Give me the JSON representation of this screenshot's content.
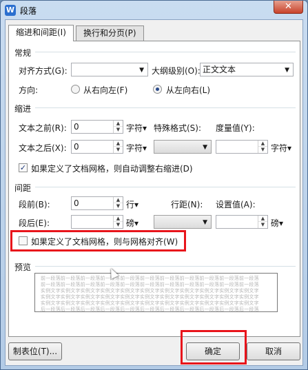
{
  "window": {
    "title": "段落",
    "close": "✕"
  },
  "tabs": [
    {
      "label": "缩进和间距(I)"
    },
    {
      "label": "换行和分页(P)"
    }
  ],
  "general": {
    "section": "常规",
    "align_label": "对齐方式(G):",
    "align_value": "",
    "outline_label": "大纲级别(O):",
    "outline_value": "正文文本",
    "direction_label": "方向:",
    "rtl_label": "从右向左(F)",
    "ltr_label": "从左向右(L)"
  },
  "indent": {
    "section": "缩进",
    "before_label": "文本之前(R):",
    "before_value": "0",
    "before_unit": "字符▾",
    "after_label": "文本之后(X):",
    "after_value": "0",
    "after_unit": "字符▾",
    "special_label": "特殊格式(S):",
    "special_value": "",
    "measure_label": "度量值(Y):",
    "measure_value": "",
    "measure_unit": "字符▾",
    "auto_adjust_label": "如果定义了文档网格，则自动调整右缩进(D)"
  },
  "spacing": {
    "section": "间距",
    "before_label": "段前(B):",
    "before_value": "0",
    "before_unit": "行▾",
    "after_label": "段后(E):",
    "after_value": "",
    "after_unit": "磅▾",
    "line_label": "行距(N):",
    "line_value": "",
    "set_label": "设置值(A):",
    "set_value": "",
    "set_unit": "磅▾",
    "grid_label": "如果定义了文档网格，则与网格对齐(W)"
  },
  "preview": {
    "section": "预览",
    "lines": [
      "前一段落前一段落前一段落前一段落前一段落前一段落前一段落前一段落前一段落前一段落前一段落",
      "前一段落前一段落前一段落前一段落前一段落前一段落前一段落前一段落前一段落前一段落前一段落",
      "实例文字实例文字实例文字实例文字实例文字实例文字实例文字实例文字实例文字实例文字实例文字",
      "实例文字实例文字实例文字实例文字实例文字实例文字实例文字实例文字实例文字实例文字实例文字",
      "实例文字实例文字实例文字实例文字实例文字实例文字实例文字实例文字实例文字实例文字实例文字",
      "后一段落后一段落后一段落后一段落后一段落后一段落后一段落后一段落后一段落后一段落后一段落"
    ]
  },
  "buttons": {
    "tabs": "制表位(T)...",
    "ok": "确定",
    "cancel": "取消"
  },
  "colors": {
    "highlight": "#e8141b"
  }
}
